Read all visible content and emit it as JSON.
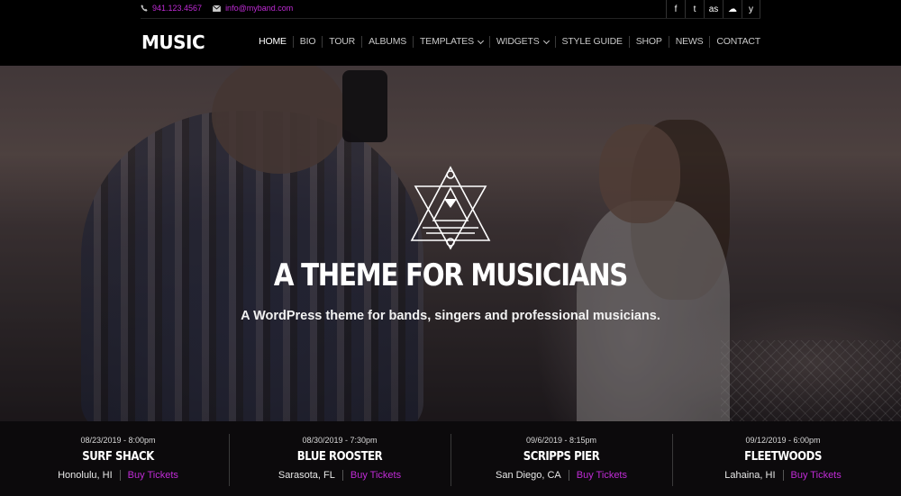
{
  "topbar": {
    "phone": "941.123.4567",
    "email": "info@myband.com",
    "social": [
      {
        "icon": "facebook-icon",
        "glyph": "f"
      },
      {
        "icon": "twitter-icon",
        "glyph": "t"
      },
      {
        "icon": "lastfm-icon",
        "glyph": "as"
      },
      {
        "icon": "soundcloud-icon",
        "glyph": "☁"
      },
      {
        "icon": "yelp-icon",
        "glyph": "y"
      }
    ]
  },
  "header": {
    "logo": "MUSIC",
    "nav": [
      {
        "label": "HOME"
      },
      {
        "label": "BIO"
      },
      {
        "label": "TOUR"
      },
      {
        "label": "ALBUMS"
      },
      {
        "label": "TEMPLATES"
      },
      {
        "label": "WIDGETS"
      },
      {
        "label": "STYLE GUIDE"
      },
      {
        "label": "SHOP"
      },
      {
        "label": "NEWS"
      },
      {
        "label": "CONTACT"
      }
    ]
  },
  "hero": {
    "title": "A THEME FOR MUSICIANS",
    "subtitle": "A WordPress theme for bands, singers and professional musicians."
  },
  "events": [
    {
      "date": "08/23/2019 - 8:00pm",
      "venue": "SURF SHACK",
      "location": "Honolulu, HI",
      "cta": "Buy Tickets"
    },
    {
      "date": "08/30/2019 - 7:30pm",
      "venue": "BLUE ROOSTER",
      "location": "Sarasota, FL",
      "cta": "Buy Tickets"
    },
    {
      "date": "09/6/2019 - 8:15pm",
      "venue": "SCRIPPS PIER",
      "location": "San Diego, CA",
      "cta": "Buy Tickets"
    },
    {
      "date": "09/12/2019 - 6:00pm",
      "venue": "FLEETWOODS",
      "location": "Lahaina, HI",
      "cta": "Buy Tickets"
    }
  ],
  "colors": {
    "accent": "#c02bd6",
    "background": "#000000"
  }
}
